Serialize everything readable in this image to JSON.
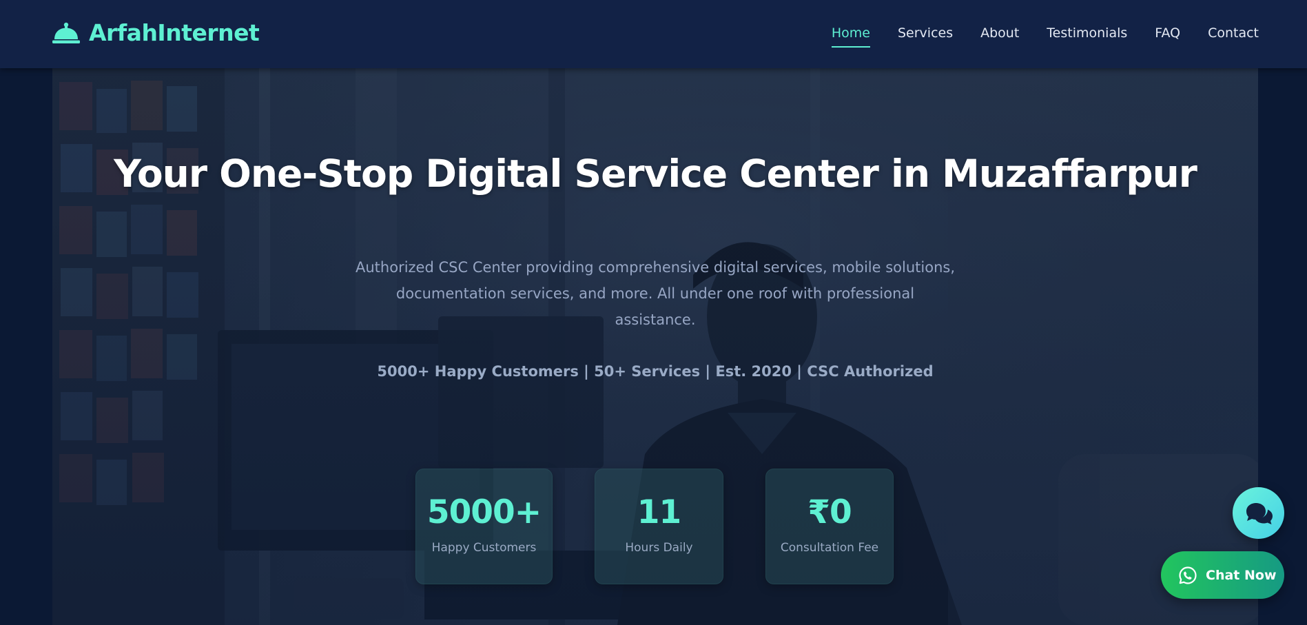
{
  "header": {
    "brand": {
      "name": "ArfahInternet",
      "icon": "service-bell-icon"
    },
    "nav": {
      "items": [
        {
          "label": "Home",
          "active": true
        },
        {
          "label": "Services",
          "active": false
        },
        {
          "label": "About",
          "active": false
        },
        {
          "label": "Testimonials",
          "active": false
        },
        {
          "label": "FAQ",
          "active": false
        },
        {
          "label": "Contact",
          "active": false
        }
      ]
    }
  },
  "hero": {
    "title": "Your One-Stop Digital Service Center in Muzaffarpur",
    "subtitle_line1": "Authorized CSC Center providing comprehensive digital services, mobile solutions,",
    "subtitle_line2": "documentation services, and more. All under one roof with professional assistance.",
    "highlights": "5000+ Happy Customers | 50+ Services | Est. 2020 | CSC Authorized",
    "background_image": "shop-worker-at-computer-photo",
    "stats": [
      {
        "value": "5000+",
        "label": "Happy Customers"
      },
      {
        "value": "11",
        "label": "Hours Daily"
      },
      {
        "value": "₹0",
        "label": "Consultation Fee"
      }
    ]
  },
  "floating": {
    "chat_icon": "chat-bubbles-icon",
    "whatsapp": {
      "icon": "whatsapp-icon",
      "label": "Chat Now"
    }
  },
  "colors": {
    "accent": "#5ef0d2",
    "header_bg": "#122246",
    "page_bg": "#0b1934",
    "whatsapp_green": "#22c55e"
  }
}
